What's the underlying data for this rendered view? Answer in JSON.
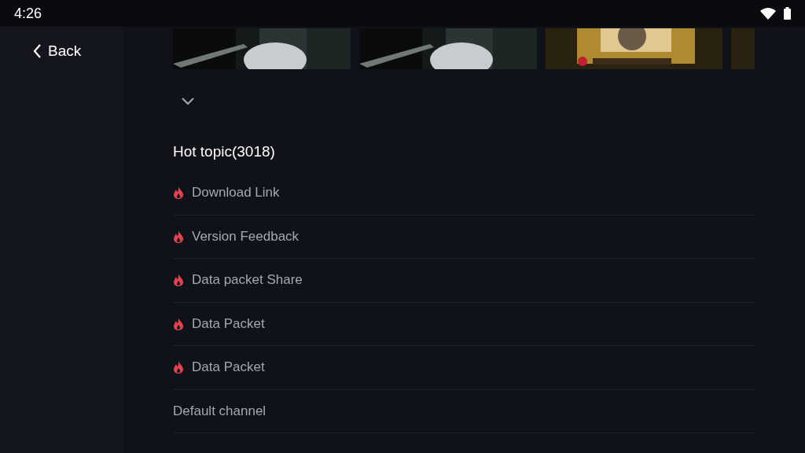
{
  "status_bar": {
    "time": "4:26"
  },
  "sidebar": {
    "back": "Back"
  },
  "section": {
    "title": "Hot topic(3018)"
  },
  "topics": [
    {
      "label": "Download Link",
      "hot": true
    },
    {
      "label": "Version Feedback",
      "hot": true
    },
    {
      "label": "Data packet Share",
      "hot": true
    },
    {
      "label": "Data Packet",
      "hot": true
    },
    {
      "label": "Data Packet",
      "hot": true
    },
    {
      "label": "Default channel",
      "hot": false
    }
  ]
}
